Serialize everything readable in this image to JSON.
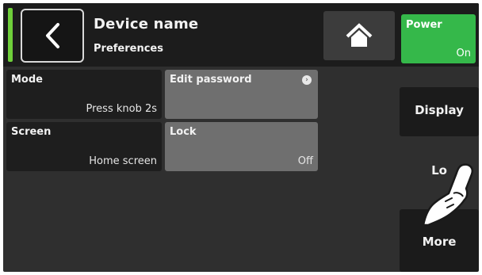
{
  "header": {
    "title": "Device name",
    "subtitle": "Preferences",
    "back_icon": "chevron-left-icon",
    "home_icon": "home-icon",
    "power": {
      "label": "Power",
      "value": "On",
      "color": "#35b84a"
    },
    "status_color": "#6fcf3a"
  },
  "tiles": {
    "mode": {
      "label": "Mode",
      "value": "Press knob 2s"
    },
    "screen": {
      "label": "Screen",
      "value": "Home screen"
    },
    "edit_password": {
      "label": "Edit password",
      "icon": "info-icon"
    },
    "lock": {
      "label": "Lock",
      "value": "Off"
    }
  },
  "tabs": {
    "display": "Display",
    "lock": "Lo",
    "more": "More"
  }
}
